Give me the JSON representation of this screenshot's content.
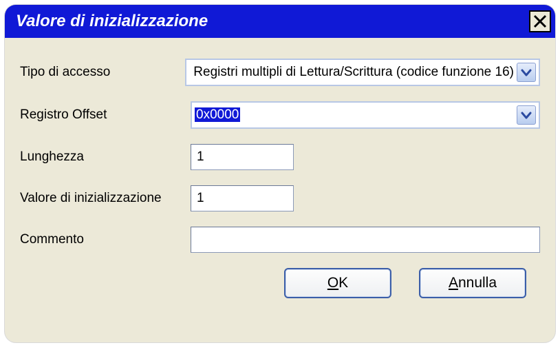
{
  "window": {
    "title": "Valore di inizializzazione"
  },
  "fields": {
    "access_type": {
      "label": "Tipo di accesso",
      "value": "Registri multipli di Lettura/Scrittura (codice funzione 16)"
    },
    "register_offset": {
      "label": "Registro Offset",
      "value": "0x0000"
    },
    "length": {
      "label": "Lunghezza",
      "value": "1"
    },
    "init_value": {
      "label": "Valore di inizializzazione",
      "value": "1"
    },
    "comment": {
      "label": "Commento",
      "value": ""
    }
  },
  "buttons": {
    "ok_prefix": "O",
    "ok_rest": "K",
    "cancel_prefix": "A",
    "cancel_rest": "nnulla"
  }
}
